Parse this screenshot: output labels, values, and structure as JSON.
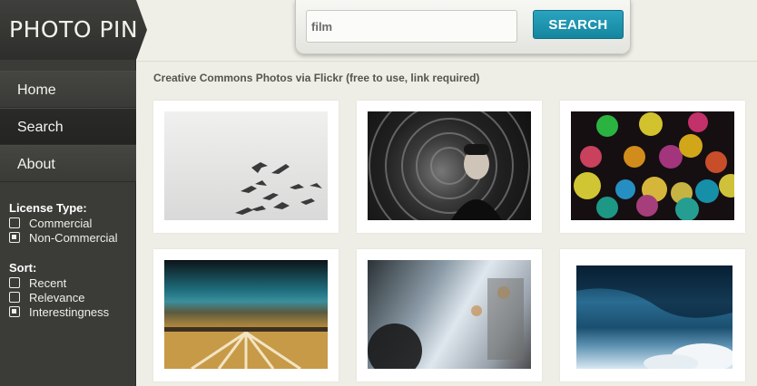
{
  "logo": "PHOTO PIN",
  "nav": [
    "Home",
    "Search",
    "About"
  ],
  "filters": {
    "license": {
      "title": "License Type:",
      "options": [
        {
          "label": "Commercial",
          "checked": false
        },
        {
          "label": "Non-Commercial",
          "checked": true
        }
      ]
    },
    "sort": {
      "title": "Sort:",
      "options": [
        {
          "label": "Recent",
          "checked": false
        },
        {
          "label": "Relevance",
          "checked": false
        },
        {
          "label": "Interestingness",
          "checked": true
        }
      ]
    }
  },
  "search": {
    "value": "film",
    "button_label": "SEARCH"
  },
  "main": {
    "heading": "Creative Commons Photos via Flickr (free to use, link required)"
  },
  "colors": {
    "accent": "#1a94ae",
    "sidebar": "#3b3b38",
    "background": "#eeeee6"
  }
}
